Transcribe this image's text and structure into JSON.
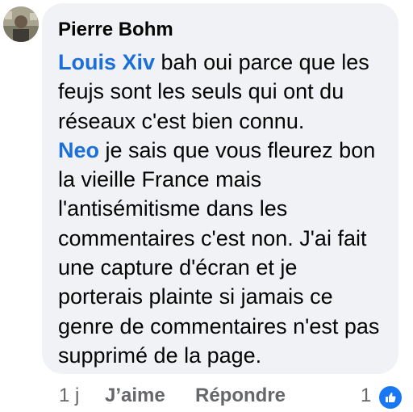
{
  "comment": {
    "author": "Pierre Bohm",
    "paragraphs": [
      {
        "mention": "Louis Xiv",
        "text": " bah oui parce que les feujs sont les seuls qui ont du réseaux c'est bien connu."
      },
      {
        "mention": "Neo",
        "text": " je sais que vous fleurez bon la vieille France mais l'antisémitisme dans les commentaires c'est non. J'ai fait une capture d'écran et je porterais plainte si jamais ce genre de commentaires n'est pas supprimé de la page."
      }
    ]
  },
  "actions": {
    "time": "1 j",
    "like_label": "J’aime",
    "reply_label": "Répondre",
    "reaction_count": "1",
    "reaction_icon": "thumbs-up-icon"
  },
  "colors": {
    "bubble_bg": "#f0f2f5",
    "mention": "#1a6fd8",
    "meta_text": "#65676b",
    "like_badge": "#1877f2"
  }
}
